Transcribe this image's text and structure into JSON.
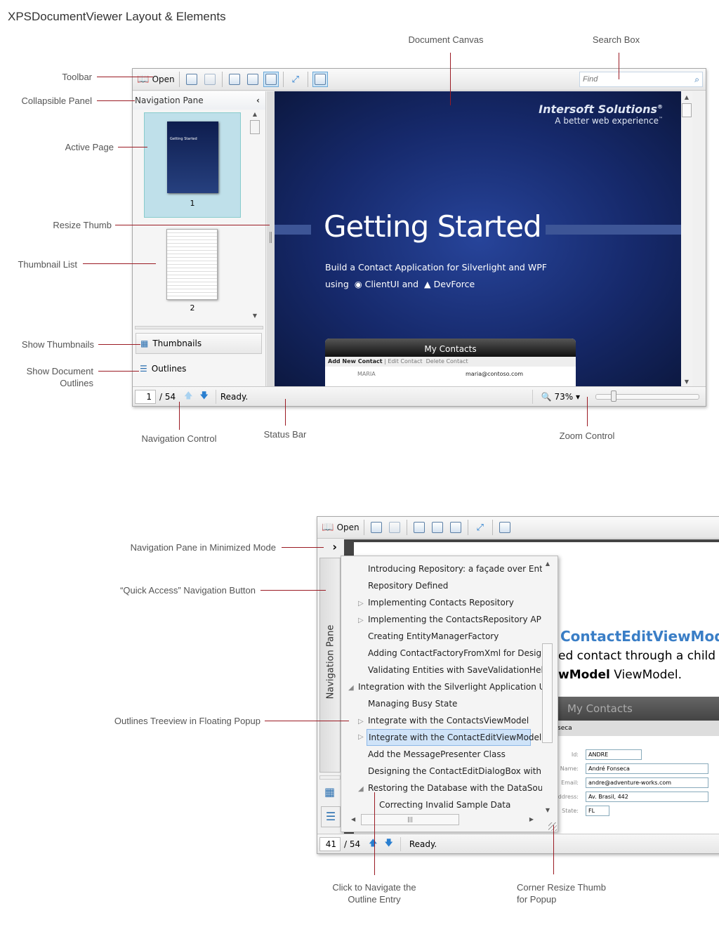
{
  "title": "XPSDocumentViewer Layout & Elements",
  "annotations": {
    "document_canvas": "Document Canvas",
    "search_box": "Search Box",
    "toolbar": "Toolbar",
    "collapsible_panel": "Collapsible Panel",
    "active_page": "Active Page",
    "resize_thumb": "Resize Thumb",
    "thumbnail_list": "Thumbnail List",
    "show_thumbnails": "Show Thumbnails",
    "show_outlines": "Show Document Outlines",
    "navigation_control": "Navigation Control",
    "status_bar": "Status Bar",
    "zoom_control": "Zoom Control",
    "nav_minimized": "Navigation Pane in Minimized Mode",
    "quick_access": "“Quick Access” Navigation Button",
    "outlines_popup": "Outlines Treeview in Floating Popup",
    "click_navigate": "Click to Navigate the Outline Entry",
    "corner_resize": "Corner Resize Thumb for Popup"
  },
  "viewer1": {
    "toolbar": {
      "open_label": "Open",
      "find_placeholder": "Find"
    },
    "nav_pane": {
      "title": "Navigation Pane",
      "thumbnails": [
        {
          "page": "1",
          "label": "Getting Started"
        },
        {
          "page": "2"
        }
      ],
      "thumbnails_button": "Thumbnails",
      "outlines_button": "Outlines"
    },
    "document": {
      "brand": "Intersoft Solutions",
      "brand_mark": "®",
      "tagline": "A better web experience",
      "tm": "™",
      "heading": "Getting Started",
      "subtitle_1": "Build a Contact Application for Silverlight and WPF",
      "subtitle_2_prefix": "using",
      "product_1": "ClientUI and",
      "product_2": "DevForce",
      "app": {
        "title": "My Contacts",
        "actions": [
          "Add New Contact",
          "Edit Contact",
          "Delete Contact"
        ],
        "name": "MARIA",
        "email": "maria@contoso.com"
      }
    },
    "status": {
      "page": "1",
      "total": "/ 54",
      "text": "Ready.",
      "zoom": "73%",
      "zoom_slider": 0.15
    }
  },
  "viewer2": {
    "toolbar": {
      "open_label": "Open"
    },
    "nav_strip_label": "Navigation Pane",
    "outline": [
      {
        "text": "Introducing Repository: a façade over Entity",
        "level": 2,
        "arrow": ""
      },
      {
        "text": "Repository Defined",
        "level": 2,
        "arrow": ""
      },
      {
        "text": "Implementing Contacts Repository",
        "level": 2,
        "arrow": "▷"
      },
      {
        "text": "Implementing the ContactsRepository API",
        "level": 2,
        "arrow": "▷"
      },
      {
        "text": "Creating EntityManagerFactory",
        "level": 2,
        "arrow": ""
      },
      {
        "text": "Adding ContactFactoryFromXml for Design-t",
        "level": 2,
        "arrow": ""
      },
      {
        "text": "Validating Entities with SaveValidationHelpe",
        "level": 2,
        "arrow": ""
      },
      {
        "text": "Integration with the Silverlight Application UI",
        "level": 1,
        "arrow": "◢"
      },
      {
        "text": "Managing Busy State",
        "level": 2,
        "arrow": ""
      },
      {
        "text": "Integrate with the ContactsViewModel",
        "level": 2,
        "arrow": "▷"
      },
      {
        "text": "Integrate with the ContactEditViewModel",
        "level": 2,
        "arrow": "▷",
        "selected": true
      },
      {
        "text": "Add the MessagePresenter Class",
        "level": 2,
        "arrow": ""
      },
      {
        "text": "Designing the ContactEditDialogBox with a '",
        "level": 2,
        "arrow": ""
      },
      {
        "text": "Restoring the Database with the DataSourc",
        "level": 2,
        "arrow": "◢"
      },
      {
        "text": "Correcting Invalid Sample Data",
        "level": 3,
        "arrow": ""
      }
    ],
    "document": {
      "heading": "ContactEditViewModel",
      "line1": "ed contact through a child wi",
      "line2_bold": "wModel",
      "line2_rest": " ViewModel.",
      "app_title": "My Contacts",
      "crumb": "seca",
      "form": [
        {
          "label": "Id:",
          "value": "ANDRE"
        },
        {
          "label": "Name:",
          "value": "André Fonseca"
        },
        {
          "label": "Email:",
          "value": "andre@adventure-works.com"
        },
        {
          "label": "Address:",
          "value": "Av. Brasil, 442"
        },
        {
          "label": "State:",
          "value": "FL"
        }
      ]
    },
    "status": {
      "page": "41",
      "total": "/ 54",
      "text": "Ready."
    }
  },
  "colors": {
    "callout_line": "#9b1b24",
    "doc_blue": "#1a2f6e",
    "selection": "#cfe3f8",
    "heading_blue": "#3a7ec6"
  }
}
